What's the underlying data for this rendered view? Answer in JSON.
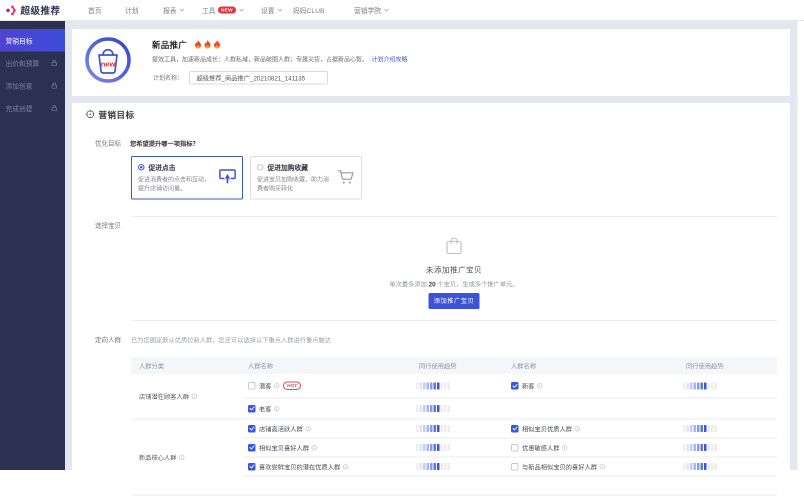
{
  "nav": {
    "logo": "超级推荐",
    "items": [
      {
        "label": "首页",
        "dropdown": false,
        "badge": ""
      },
      {
        "label": "计划",
        "dropdown": false,
        "badge": ""
      },
      {
        "label": "报表",
        "dropdown": true,
        "badge": ""
      },
      {
        "label": "工具",
        "dropdown": true,
        "badge": "NEW"
      },
      {
        "label": "设置",
        "dropdown": true,
        "badge": ""
      },
      {
        "label": "妈妈CLUB",
        "dropdown": false,
        "badge": ""
      },
      {
        "label": "营销学院",
        "dropdown": true,
        "badge": ""
      }
    ]
  },
  "sidebar": {
    "steps": [
      {
        "label": "营销目标",
        "active": true,
        "locked": false
      },
      {
        "label": "出价和预算",
        "active": false,
        "locked": true
      },
      {
        "label": "添加创意",
        "active": false,
        "locked": true
      },
      {
        "label": "完成创建",
        "active": false,
        "locked": true
      }
    ]
  },
  "header": {
    "title": "新品推广",
    "flames": 3,
    "description": "提效工具，加速新品成长：人群私域，新品破圈人群；专属尖货，占据新品心智。",
    "intro_link": "计划介绍攻略",
    "plan_name_label": "计划名称：",
    "plan_name_value": "超级推荐_商品推广_20210821_141135"
  },
  "goal_section": {
    "title": "营销目标",
    "optimize_label": "优化目标",
    "question": "您希望提升哪一项指标？",
    "options": [
      {
        "title": "促进点击",
        "desc": "促进消费者的点击和互动，提升店铺访问量。",
        "selected": true,
        "icon": "click"
      },
      {
        "title": "促进加购收藏",
        "desc": "促进宝贝加购收藏，助力消费者购买转化",
        "selected": false,
        "icon": "cart"
      }
    ]
  },
  "items_section": {
    "label": "选择宝贝",
    "empty_title": "未添加推广宝贝",
    "hint_prefix": "单次最多添加 ",
    "hint_count": "20",
    "hint_suffix": " 个宝贝，生成多个推广单元。",
    "add_button": "添加推广宝贝"
  },
  "audience_section": {
    "label": "定向人群",
    "description": "已为您圈定默认优质拉新人群，您还可以选择以下重点人群进行重点触达",
    "headers": [
      "人群分类",
      "人群名称",
      "同行使用趋势",
      "人群名称",
      "同行使用趋势"
    ],
    "groups": [
      {
        "category": "店铺潜在顾客人群",
        "rows": [
          {
            "left": {
              "label": "潜客",
              "checked": false,
              "hot": true
            },
            "right": {
              "label": "新客",
              "checked": true,
              "hot": false
            }
          },
          {
            "left": {
              "label": "老客",
              "checked": true,
              "hot": false
            },
            "right": null
          }
        ]
      },
      {
        "category": "新品核心人群",
        "rows": [
          {
            "left": {
              "label": "店铺高活跃人群",
              "checked": true,
              "hot": false
            },
            "right": {
              "label": "相似宝贝优质人群",
              "checked": true,
              "hot": false
            }
          },
          {
            "left": {
              "label": "相似宝贝喜好人群",
              "checked": true,
              "hot": false
            },
            "right": {
              "label": "优惠敏感人群",
              "checked": false,
              "hot": false
            }
          },
          {
            "left": {
              "label": "喜欢尝鲜宝贝的潜在优质人群",
              "checked": true,
              "hot": false
            },
            "right": {
              "label": "与新品相似宝贝的喜好人群",
              "checked": false,
              "hot": false
            }
          },
          {
            "left": null,
            "right": null
          }
        ]
      }
    ],
    "hot_text": "HOT"
  },
  "colors": {
    "accent": "#3b57d6",
    "logo_pink": "#f5256d",
    "logo_magenta": "#b62a8a",
    "new_red": "#e4303c",
    "hot_red": "#e5484f",
    "sidebar_bg": "#2b3150",
    "page_bg": "#e4e7f0",
    "trend_shades": [
      "#eceefb",
      "#dde3f8",
      "#c3ccf4",
      "#a7b4ef",
      "#8a9aea",
      "#5b74df",
      "#3b57d6",
      "#ededf1",
      "#ededf1",
      "#ededf1"
    ]
  }
}
